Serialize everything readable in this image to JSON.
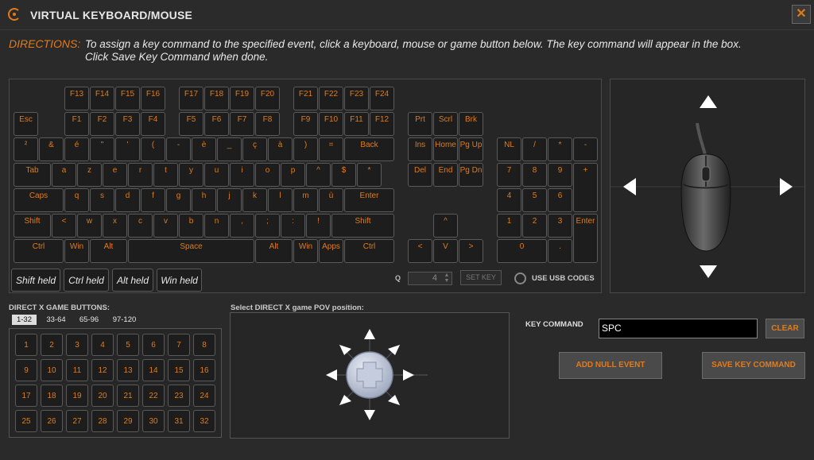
{
  "window": {
    "title": "VIRTUAL KEYBOARD/MOUSE",
    "close_label": "✕"
  },
  "directions": {
    "label": "DIRECTIONS:",
    "line1": "To assign a key command to the specified event, click a keyboard, mouse or game button below. The key command will appear in the box.",
    "line2": "Click Save Key Command when done."
  },
  "keyboard": {
    "fn_high": [
      "F13",
      "F14",
      "F15",
      "F16",
      "F17",
      "F18",
      "F19",
      "F20",
      "F21",
      "F22",
      "F23",
      "F24"
    ],
    "esc": "Esc",
    "fn_low": [
      "F1",
      "F2",
      "F3",
      "F4",
      "F5",
      "F6",
      "F7",
      "F8",
      "F9",
      "F10",
      "F11",
      "F12"
    ],
    "row1": [
      "²",
      "&",
      "é",
      "\"",
      "'",
      "(",
      "-",
      "è",
      "_",
      "ç",
      "à",
      ")",
      "="
    ],
    "backspace": "Back",
    "tab": "Tab",
    "row2": [
      "a",
      "z",
      "e",
      "r",
      "t",
      "y",
      "u",
      "i",
      "o",
      "p",
      "^",
      "$",
      "*"
    ],
    "caps": "Caps",
    "row3": [
      "q",
      "s",
      "d",
      "f",
      "g",
      "h",
      "j",
      "k",
      "l",
      "m",
      "ù"
    ],
    "enter": "Enter",
    "lshift": "Shift",
    "row4": [
      "<",
      "w",
      "x",
      "c",
      "v",
      "b",
      "n",
      ",",
      ";",
      ":",
      "!"
    ],
    "rshift": "Shift",
    "bottom": {
      "lctrl": "Ctrl",
      "lwin": "Win",
      "lalt": "Alt",
      "space": "Space",
      "ralt": "Alt",
      "rwin": "Win",
      "apps": "Apps",
      "rctrl": "Ctrl"
    },
    "sys": [
      "Prt",
      "Scrl",
      "Brk"
    ],
    "nav1": [
      "Ins",
      "Home",
      "Pg Up"
    ],
    "nav2": [
      "Del",
      "End",
      "Pg Dn"
    ],
    "arrows": {
      "up": "^",
      "left": "<",
      "down": "V",
      "right": ">"
    },
    "numpad": {
      "row1": [
        "NL",
        "/",
        "*",
        "-"
      ],
      "row2": [
        "7",
        "8",
        "9"
      ],
      "plus": "+",
      "row3": [
        "4",
        "5",
        "6"
      ],
      "row4": [
        "1",
        "2",
        "3"
      ],
      "enter": "Enter",
      "zero": "0",
      "dot": "."
    },
    "holds": [
      "Shift held",
      "Ctrl held",
      "Alt held",
      "Win held"
    ],
    "q_label": "Q",
    "q_value": "4",
    "set_key": "SET KEY",
    "usb_label": "USE USB CODES"
  },
  "game_buttons": {
    "label": "DIRECT X GAME BUTTONS:",
    "tabs": [
      "1-32",
      "33-64",
      "65-96",
      "97-120"
    ],
    "selected_tab": "1-32",
    "buttons": [
      "1",
      "2",
      "3",
      "4",
      "5",
      "6",
      "7",
      "8",
      "9",
      "10",
      "11",
      "12",
      "13",
      "14",
      "15",
      "16",
      "17",
      "18",
      "19",
      "20",
      "21",
      "22",
      "23",
      "24",
      "25",
      "26",
      "27",
      "28",
      "29",
      "30",
      "31",
      "32"
    ]
  },
  "pov": {
    "label": "Select DIRECT X game POV position:"
  },
  "key_command": {
    "label": "KEY COMMAND",
    "value": "SPC",
    "clear": "CLEAR",
    "add_null": "ADD NULL EVENT",
    "save": "SAVE KEY COMMAND"
  },
  "colors": {
    "accent": "#e07b1a",
    "background": "#2a2a2a"
  }
}
